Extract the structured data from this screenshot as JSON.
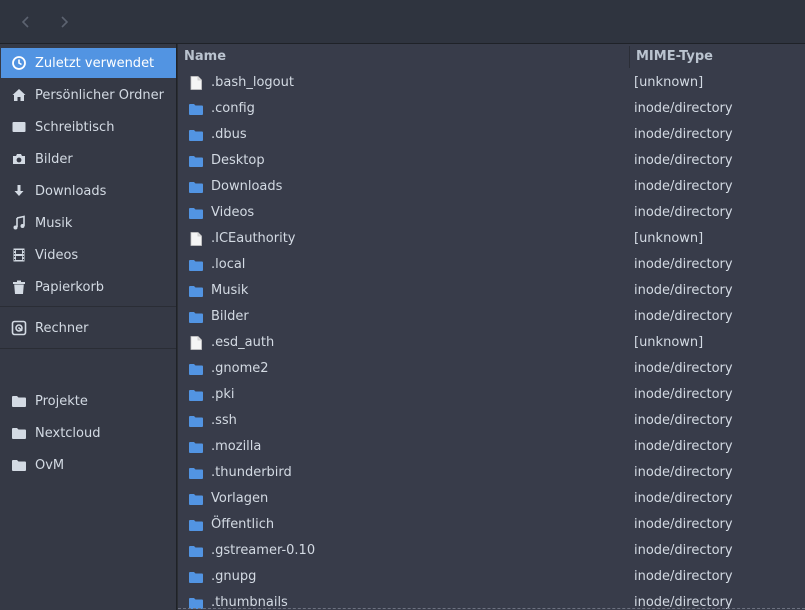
{
  "header": {
    "back_icon": "chevron-left-icon",
    "forward_icon": "chevron-right-icon"
  },
  "sidebar": {
    "items": [
      {
        "label": "Zuletzt verwendet",
        "icon": "clock-icon",
        "active": true
      },
      {
        "label": "Persönlicher Ordner",
        "icon": "home-icon"
      },
      {
        "label": "Schreibtisch",
        "icon": "desktop-icon"
      },
      {
        "label": "Bilder",
        "icon": "camera-icon"
      },
      {
        "label": "Downloads",
        "icon": "download-icon"
      },
      {
        "label": "Musik",
        "icon": "music-icon"
      },
      {
        "label": "Videos",
        "icon": "film-icon"
      },
      {
        "label": "Papierkorb",
        "icon": "trash-icon"
      },
      {
        "label": "Rechner",
        "icon": "drive-icon"
      },
      {
        "label": "Projekte",
        "icon": "folder-icon"
      },
      {
        "label": "Nextcloud",
        "icon": "folder-icon"
      },
      {
        "label": "OvM",
        "icon": "folder-icon"
      }
    ]
  },
  "columns": {
    "name": "Name",
    "mime": "MIME-Type"
  },
  "files": [
    {
      "name": ".bash_logout",
      "mime": "[unknown]",
      "icon": "file-icon"
    },
    {
      "name": ".config",
      "mime": "inode/directory",
      "icon": "folder-icon"
    },
    {
      "name": ".dbus",
      "mime": "inode/directory",
      "icon": "folder-icon"
    },
    {
      "name": "Desktop",
      "mime": "inode/directory",
      "icon": "folder-icon"
    },
    {
      "name": "Downloads",
      "mime": "inode/directory",
      "icon": "folder-icon"
    },
    {
      "name": "Videos",
      "mime": "inode/directory",
      "icon": "folder-icon"
    },
    {
      "name": ".ICEauthority",
      "mime": "[unknown]",
      "icon": "file-icon"
    },
    {
      "name": ".local",
      "mime": "inode/directory",
      "icon": "folder-icon"
    },
    {
      "name": "Musik",
      "mime": "inode/directory",
      "icon": "folder-icon"
    },
    {
      "name": "Bilder",
      "mime": "inode/directory",
      "icon": "folder-icon"
    },
    {
      "name": ".esd_auth",
      "mime": "[unknown]",
      "icon": "file-icon"
    },
    {
      "name": ".gnome2",
      "mime": "inode/directory",
      "icon": "folder-icon"
    },
    {
      "name": ".pki",
      "mime": "inode/directory",
      "icon": "folder-icon"
    },
    {
      "name": ".ssh",
      "mime": "inode/directory",
      "icon": "folder-icon"
    },
    {
      "name": ".mozilla",
      "mime": "inode/directory",
      "icon": "folder-icon"
    },
    {
      "name": ".thunderbird",
      "mime": "inode/directory",
      "icon": "folder-icon"
    },
    {
      "name": "Vorlagen",
      "mime": "inode/directory",
      "icon": "folder-icon"
    },
    {
      "name": "Öffentlich",
      "mime": "inode/directory",
      "icon": "folder-icon"
    },
    {
      "name": ".gstreamer-0.10",
      "mime": "inode/directory",
      "icon": "folder-icon"
    },
    {
      "name": ".gnupg",
      "mime": "inode/directory",
      "icon": "folder-icon"
    },
    {
      "name": ".thumbnails",
      "mime": "inode/directory",
      "icon": "folder-icon"
    }
  ],
  "colors": {
    "accent": "#5294e2",
    "folder": "#5294e2",
    "file": "#e8e8e7"
  }
}
